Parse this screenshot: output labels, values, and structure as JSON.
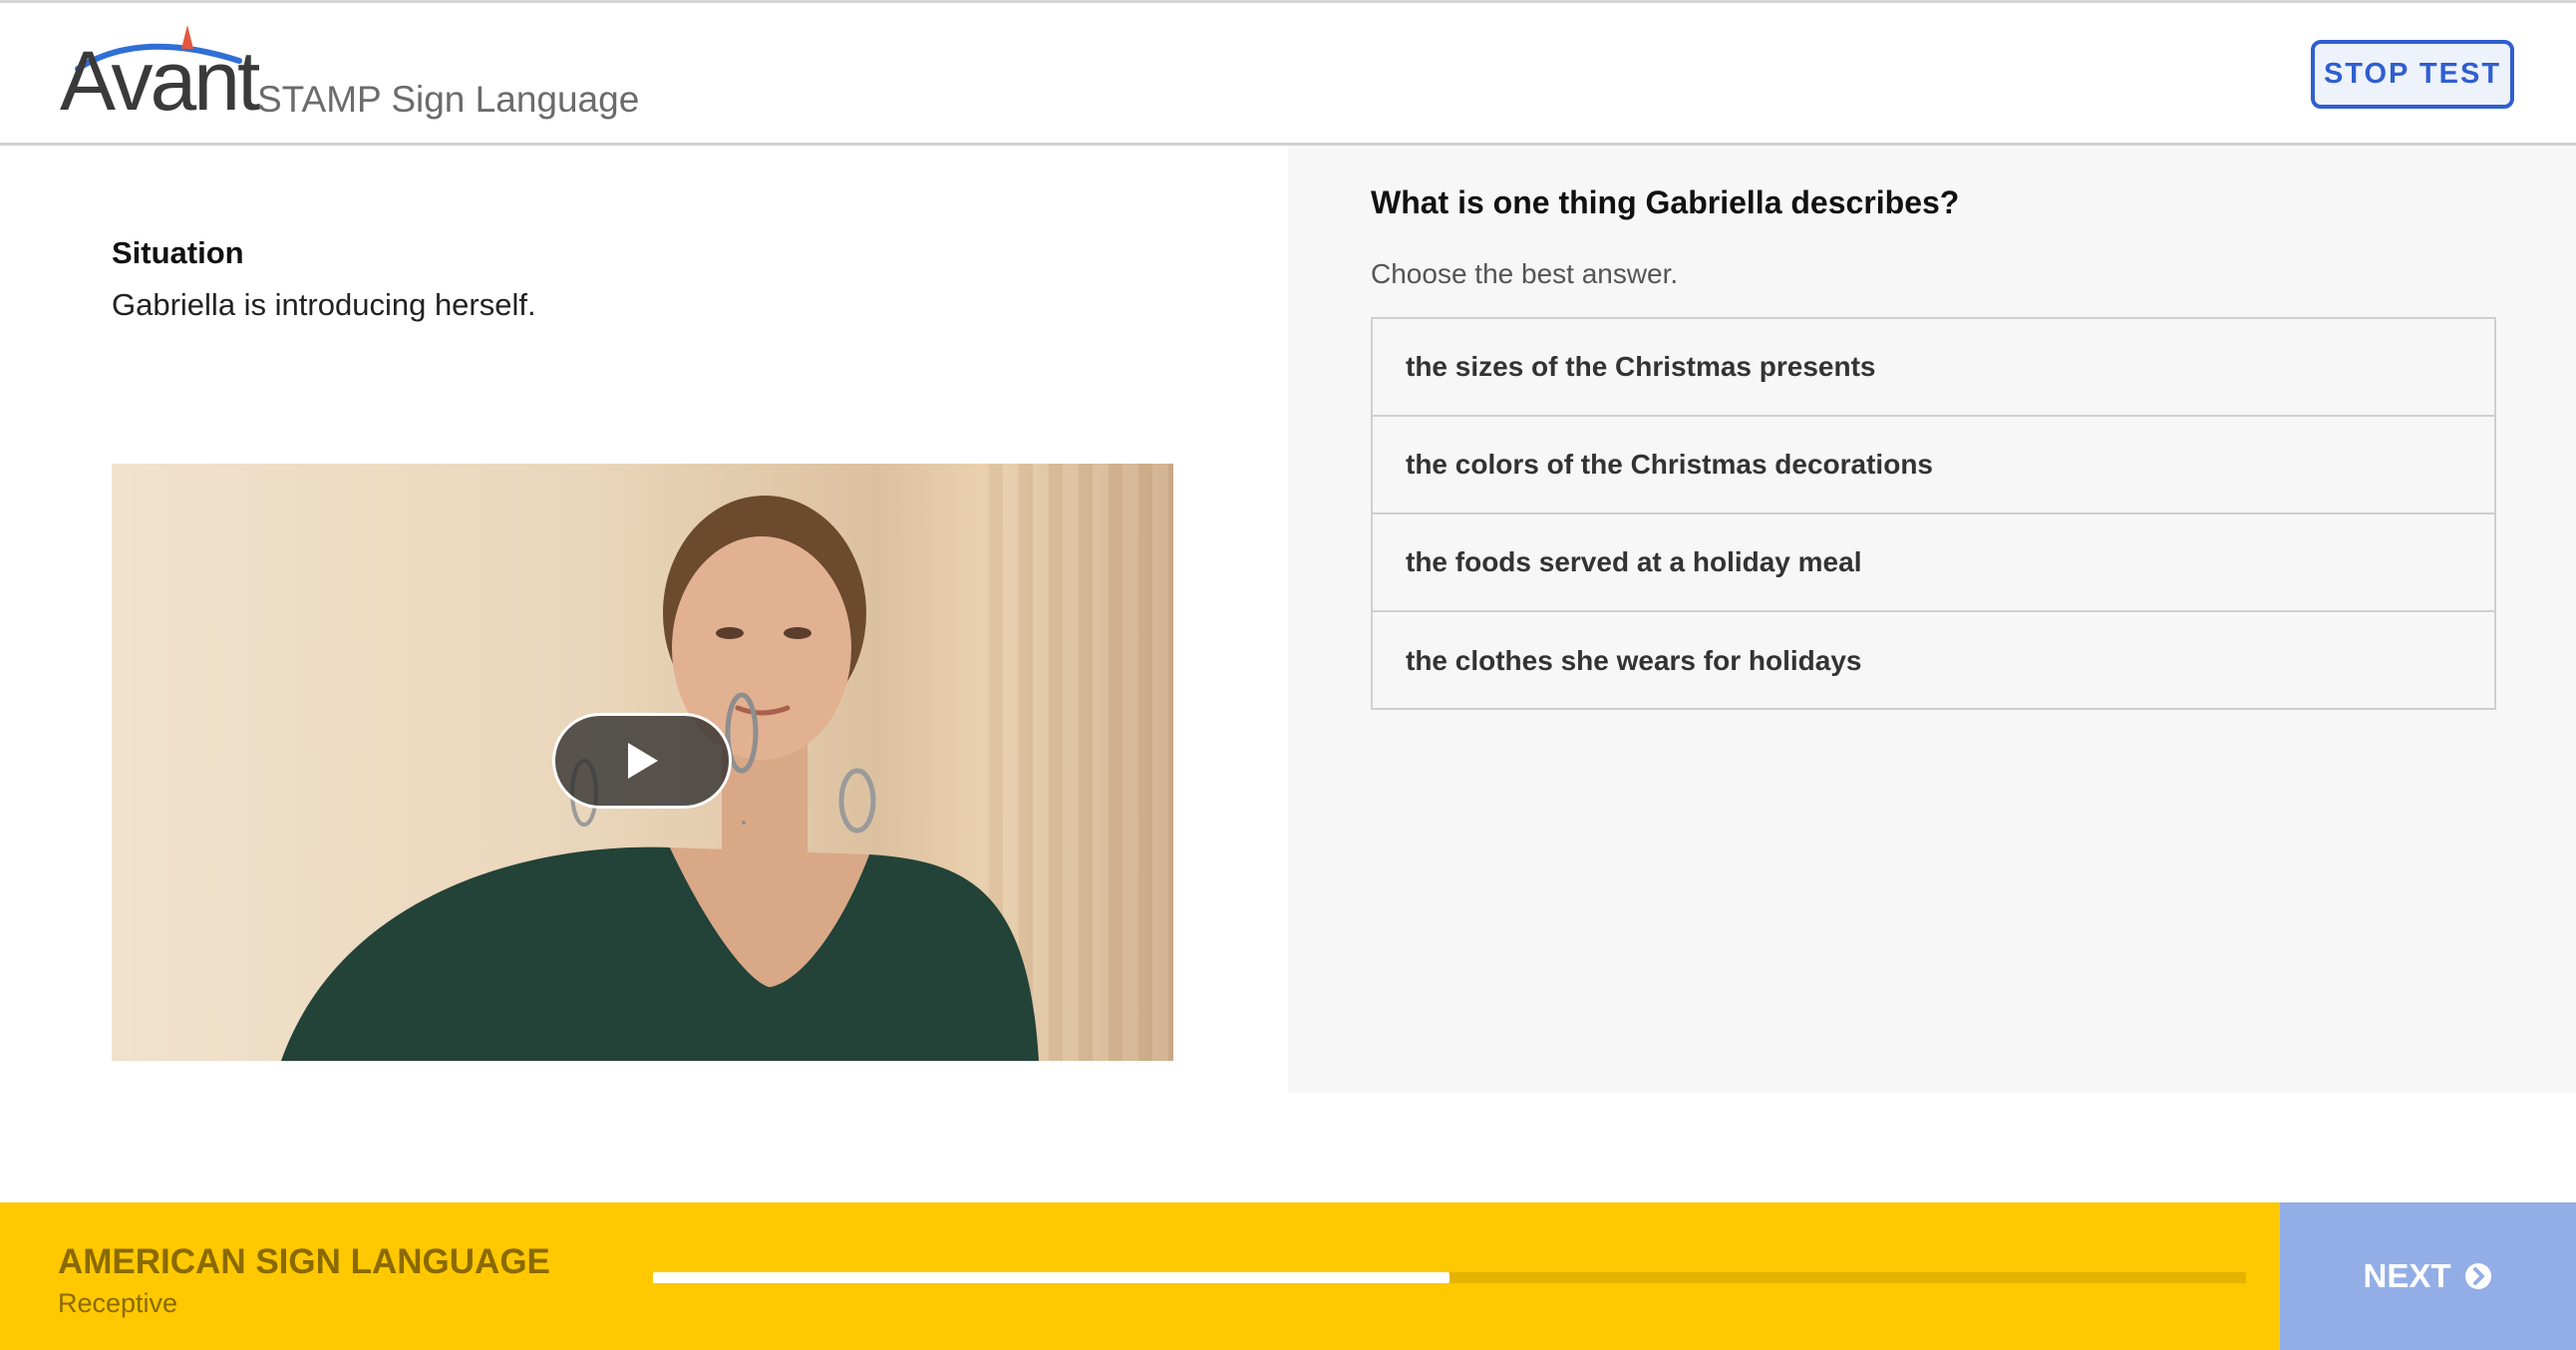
{
  "header": {
    "logo_text": "Avant",
    "product_name": "STAMP Sign Language",
    "stop_label": "STOP TEST"
  },
  "situation": {
    "label": "Situation",
    "text": "Gabriella is introducing herself."
  },
  "video": {
    "play_icon": "play-icon"
  },
  "question": {
    "prompt": "What is one thing Gabriella describes?",
    "instruction": "Choose the best answer.",
    "answers": [
      "the sizes of the Christmas presents",
      "the colors of the Christmas decorations",
      "the foods served at a holiday meal",
      "the clothes she wears for holidays"
    ]
  },
  "footer": {
    "language": "AMERICAN SIGN LANGUAGE",
    "mode": "Receptive",
    "progress_fraction": 0.5,
    "next_label": "NEXT",
    "next_icon": "chevron-right-circle-icon"
  },
  "colors": {
    "accent_blue": "#2f5fd0",
    "footer_yellow": "#ffc800",
    "next_button": "#93aee6",
    "footer_text": "#8a6a00"
  }
}
